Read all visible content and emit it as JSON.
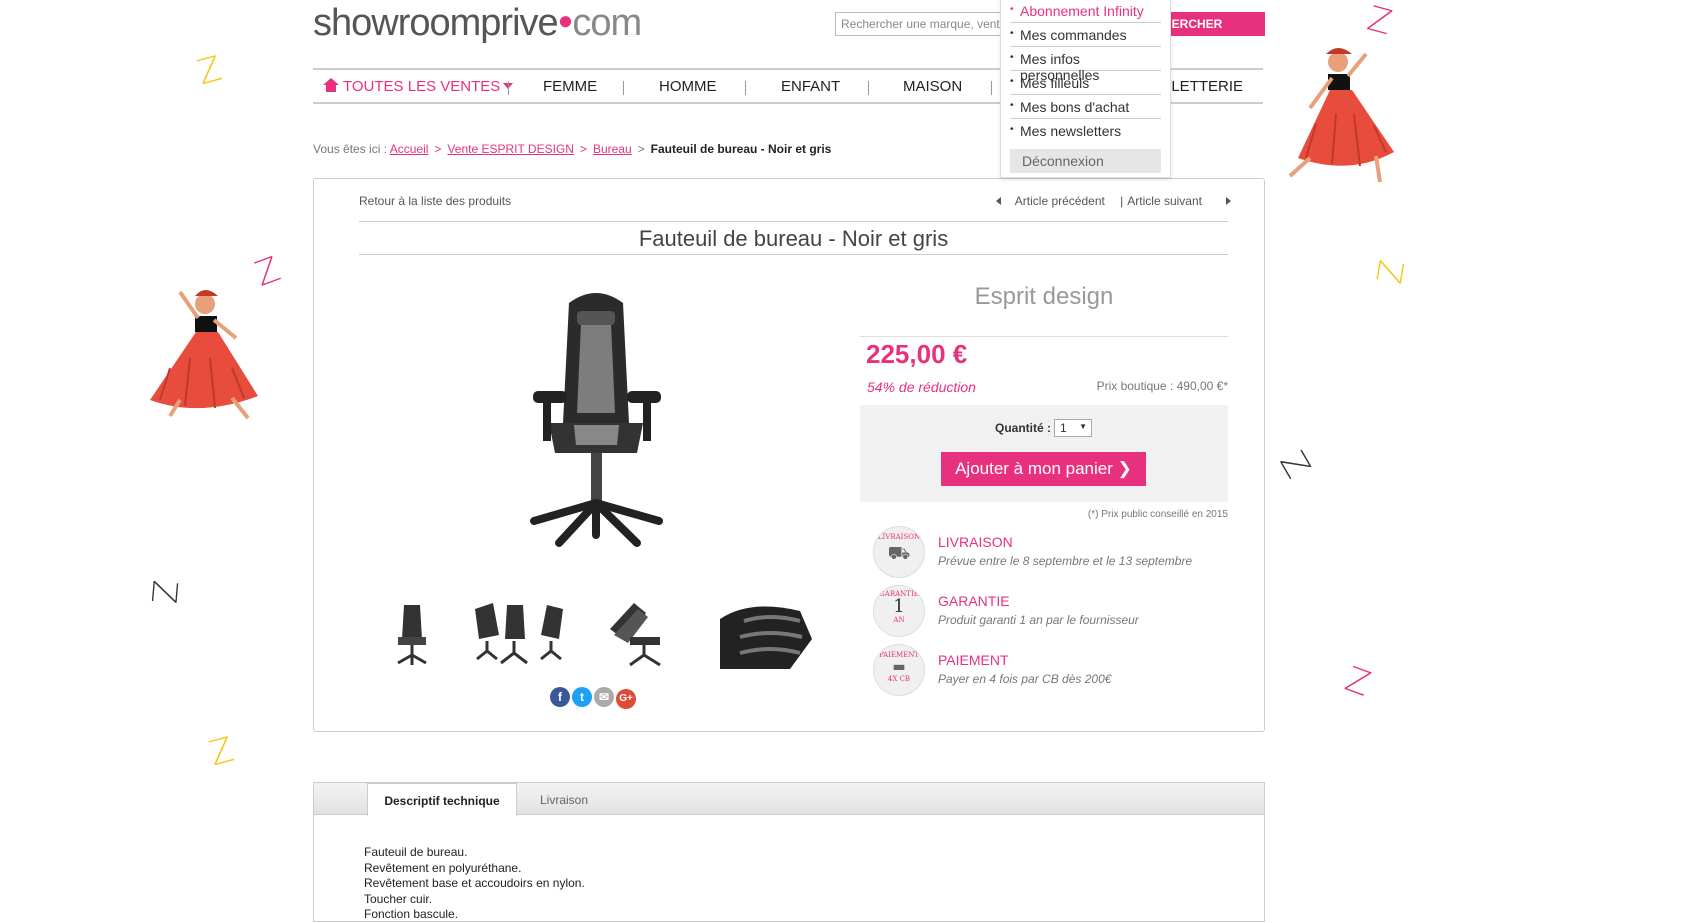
{
  "header": {
    "logo_main": "showroomprive",
    "logo_tld": "com",
    "search_placeholder": "Rechercher une marque, vente...",
    "search_button": "HERCHER"
  },
  "nav": {
    "home": "TOUTES LES VENTES",
    "items": [
      "FEMME",
      "HOMME",
      "ENFANT",
      "MAISON",
      "LLETTERIE"
    ]
  },
  "account_menu": {
    "items": [
      "Abonnement Infinity",
      "Mes commandes",
      "Mes infos personnelles",
      "Mes filleuls",
      "Mes bons d'achat",
      "Mes newsletters"
    ],
    "logout": "Déconnexion"
  },
  "breadcrumb": {
    "prefix": "Vous êtes ici :",
    "links": [
      "Accueil",
      "Vente ESPRIT DESIGN",
      "Bureau"
    ],
    "current": "Fauteuil de bureau - Noir et gris"
  },
  "product": {
    "back": "Retour à la liste des produits",
    "prev": "Article précédent",
    "next": "Article suivant",
    "title": "Fauteuil de bureau - Noir et gris",
    "brand": "Esprit design",
    "price": "225,00 €",
    "discount": "54% de réduction",
    "retail": "Prix boutique : 490,00 €*",
    "qty_label": "Quantité :",
    "qty_value": "1",
    "add_to_cart": "Ajouter à mon panier ❯",
    "footnote": "(*) Prix public conseillé en 2015",
    "features": [
      {
        "title": "LIVRAISON",
        "desc": "Prévue entre le 8 septembre et le 13 septembre",
        "badge": "LIVRAISON"
      },
      {
        "title": "GARANTIE",
        "desc": "Produit garanti 1 an par le fournisseur",
        "badge_top": "GARANTIE",
        "badge_num": "1",
        "badge_bottom": "AN"
      },
      {
        "title": "PAIEMENT",
        "desc": "Payer en 4 fois par CB dès 200€",
        "badge_top": "PAIEMENT",
        "badge_bottom": "4X CB"
      }
    ]
  },
  "tabs": {
    "items": [
      "Descriptif technique",
      "Livraison"
    ],
    "description": [
      "Fauteuil de bureau.",
      "Revêtement en polyuréthane.",
      "Revêtement base et accoudoirs en nylon.",
      "Toucher cuir.",
      "Fonction bascule."
    ]
  },
  "colors": {
    "accent": "#e8317e",
    "zigzag_yellow": "#f5c518",
    "zigzag_dark": "#444444"
  }
}
